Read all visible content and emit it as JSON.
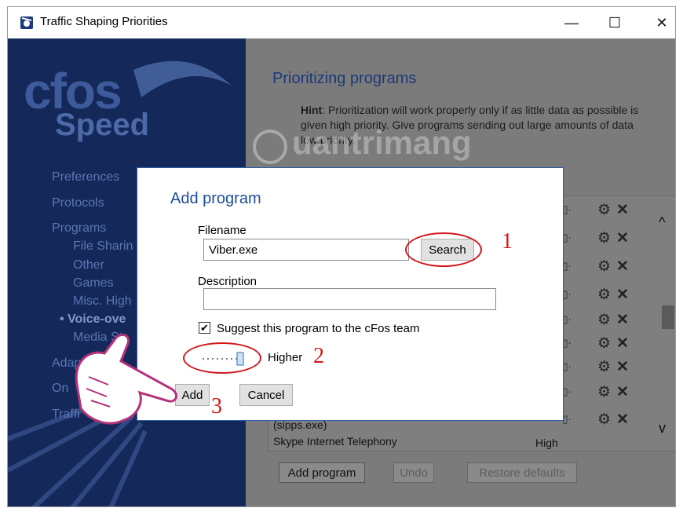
{
  "window": {
    "title": "Traffic Shaping Priorities",
    "controls": {
      "minimize": "—",
      "maximize": "☐",
      "close": "✕"
    }
  },
  "sidebar": {
    "logo_top": "cfos",
    "logo_bottom": "Speed",
    "items": [
      {
        "label": "Preferences"
      },
      {
        "label": "Protocols"
      },
      {
        "label": "Programs"
      },
      {
        "label": "File Sharin"
      },
      {
        "label": "Other"
      },
      {
        "label": "Games"
      },
      {
        "label": "Misc. High"
      },
      {
        "label": "• Voice-ove"
      },
      {
        "label": "Media Str"
      },
      {
        "label": "Adapte"
      },
      {
        "label": "On"
      },
      {
        "label": "Traffi"
      }
    ]
  },
  "main": {
    "heading": "Prioritizing programs",
    "hint_label": "Hint",
    "hint_text": ": Prioritization will work properly only if as little data as possible is given high priority. Give programs sending out large amounts of data low priority.",
    "list": {
      "item_partial": "(sipps.exe)",
      "item_name": "Skype Internet Telephony",
      "item_priority": "High"
    },
    "buttons": {
      "add_program": "Add program",
      "undo": "Undo",
      "restore_defaults": "Restore defaults"
    }
  },
  "watermark": "uantrimang",
  "dialog": {
    "title": "Add program",
    "filename_label": "Filename",
    "filename_value": "Viber.exe",
    "search_button": "Search",
    "description_label": "Description",
    "description_value": "",
    "suggest_checked": true,
    "suggest_label": "Suggest this program to the cFos team",
    "priority_label": "Higher",
    "add_button": "Add",
    "cancel_button": "Cancel"
  },
  "annotations": {
    "n1": "1",
    "n2": "2",
    "n3": "3"
  },
  "colors": {
    "sidebar_bg": "#14285a",
    "dialog_accent": "#1b4f9a",
    "annotation_red": "#d2181c",
    "dimmed_bg": "#7b7b7b"
  }
}
